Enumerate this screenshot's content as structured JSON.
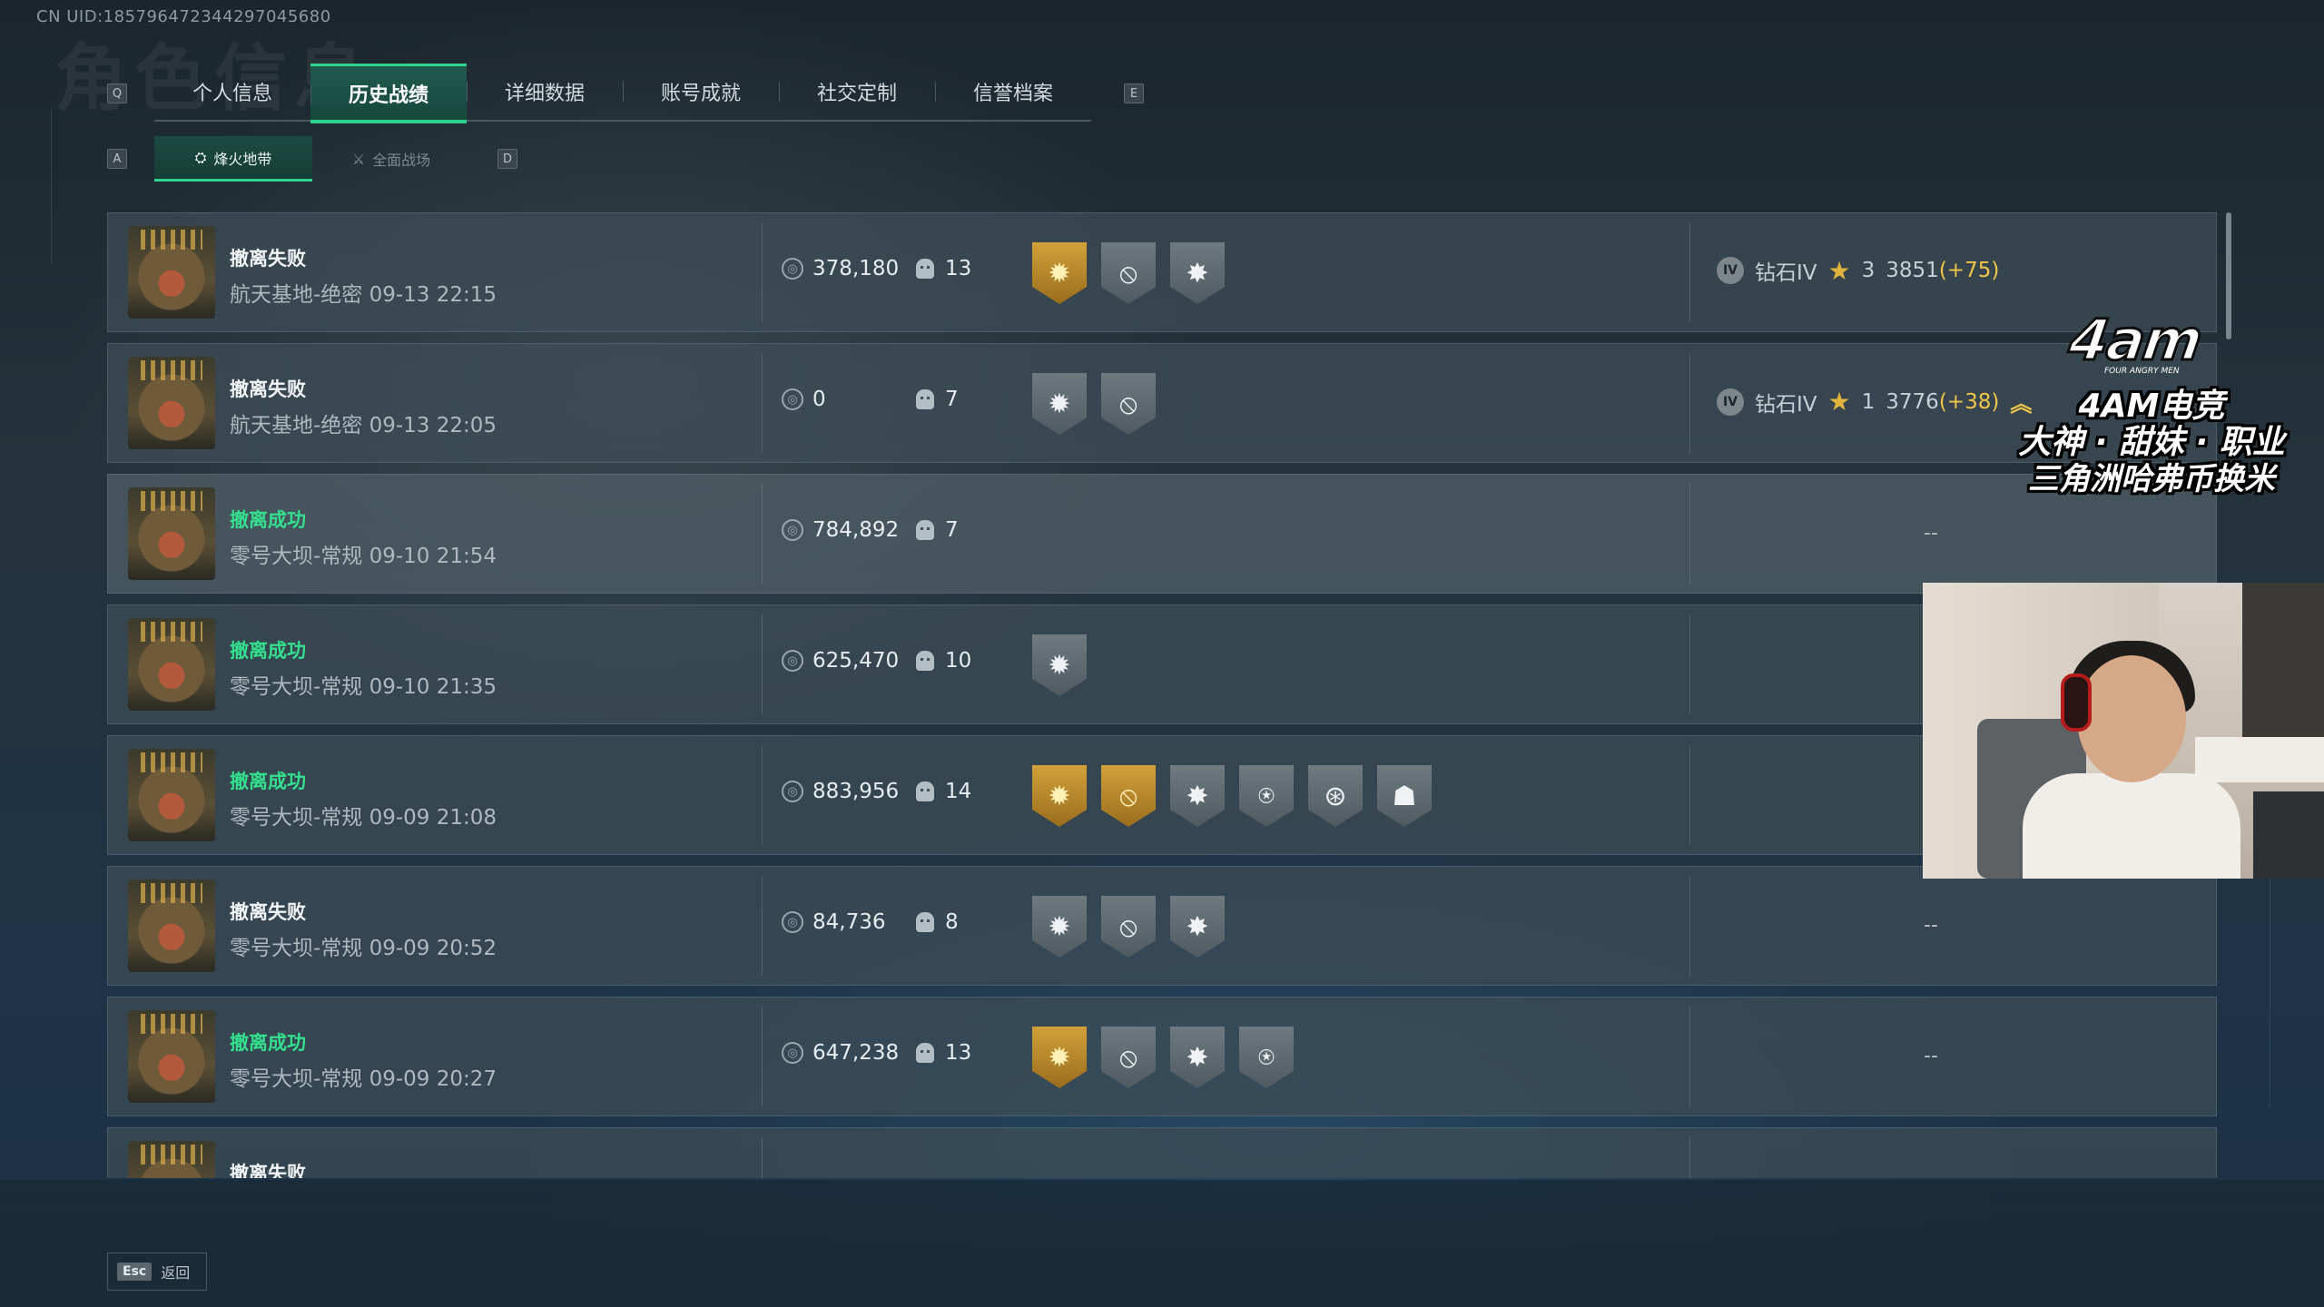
{
  "uid": "CN UID:18579647234429704568​0",
  "bg_title": "角色信息",
  "keys": {
    "tab_prev": "Q",
    "tab_next": "E",
    "sub_prev": "A",
    "sub_next": "D"
  },
  "tabs": [
    "个人信息",
    "历史战绩",
    "详细数据",
    "账号成就",
    "社交定制",
    "信誉档案"
  ],
  "active_tab": 1,
  "subtabs": [
    "烽火地带",
    "全面战场"
  ],
  "active_subtab": 0,
  "matches": [
    {
      "status": "撤离失败",
      "success": false,
      "map": "航天基地-绝密 09-13 22:15",
      "value": "378,180",
      "kills": "13",
      "medals": [
        "gold",
        "silver",
        "silver"
      ],
      "rank": {
        "icon": "IV",
        "tier": "钻石IV",
        "stars": "3",
        "points": "3851",
        "delta": "(+75)",
        "promoted": false
      }
    },
    {
      "status": "撤离失败",
      "success": false,
      "map": "航天基地-绝密 09-13 22:05",
      "value": "0",
      "kills": "7",
      "medals": [
        "silver",
        "silver"
      ],
      "rank": {
        "icon": "IV",
        "tier": "钻石IV",
        "stars": "1",
        "points": "3776",
        "delta": "(+38)",
        "promoted": true
      }
    },
    {
      "status": "撤离成功",
      "success": true,
      "map": "零号大坝-常规 09-10 21:54",
      "value": "784,892",
      "kills": "7",
      "medals": [],
      "rank": null
    },
    {
      "status": "撤离成功",
      "success": true,
      "map": "零号大坝-常规 09-10 21:35",
      "value": "625,470",
      "kills": "10",
      "medals": [
        "silver"
      ],
      "rank": null
    },
    {
      "status": "撤离成功",
      "success": true,
      "map": "零号大坝-常规 09-09 21:08",
      "value": "883,956",
      "kills": "14",
      "medals": [
        "gold",
        "gold",
        "silver",
        "silver",
        "silver",
        "silver"
      ],
      "rank": null
    },
    {
      "status": "撤离失败",
      "success": false,
      "map": "零号大坝-常规 09-09 20:52",
      "value": "84,736",
      "kills": "8",
      "medals": [
        "silver",
        "silver",
        "silver"
      ],
      "rank": null
    },
    {
      "status": "撤离成功",
      "success": true,
      "map": "零号大坝-常规 09-09 20:27",
      "value": "647,238",
      "kills": "13",
      "medals": [
        "gold",
        "silver",
        "silver",
        "silver"
      ],
      "rank": null
    },
    {
      "status": "撤离失败",
      "success": false,
      "map": "",
      "value": "",
      "kills": "",
      "medals": [],
      "rank": null
    }
  ],
  "empty_rank": "--",
  "footer": {
    "esc_key": "Esc",
    "back_label": "返回"
  },
  "overlay": {
    "logo": "4am",
    "logo_sub": "FOUR ANGRY MEN",
    "line1": "4AM电竞",
    "line2": "大神 · 甜妹 · 职业",
    "line3": "三角洲哈弗币换米"
  },
  "colors": {
    "accent": "#2dd48f",
    "success": "#34e08d",
    "gold_delta": "#f0c548"
  }
}
